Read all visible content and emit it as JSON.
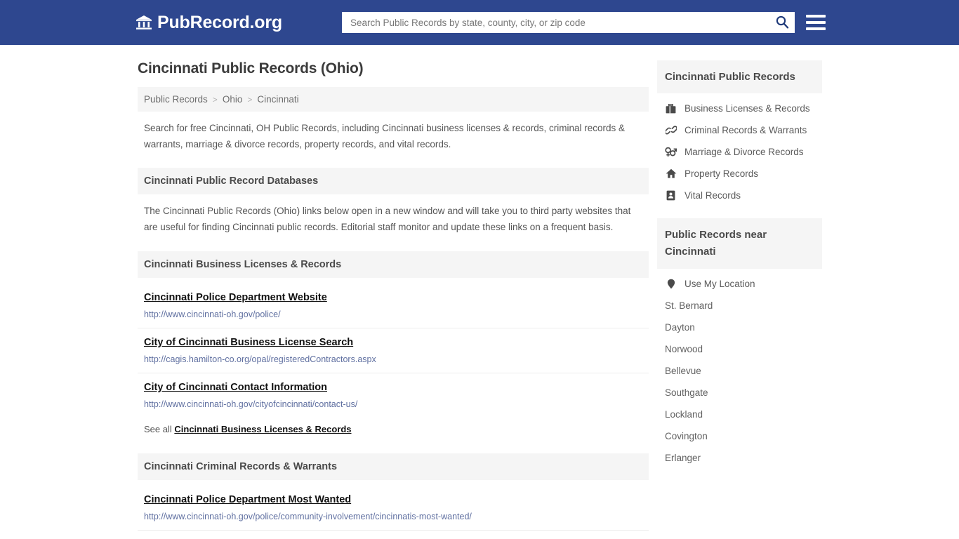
{
  "header": {
    "brand_name": "PubRecord.org",
    "brand_icon": "bank-building-icon",
    "search_placeholder": "Search Public Records by state, county, city, or zip code",
    "search_value": "",
    "search_icon": "search-icon",
    "menu_icon": "hamburger-menu-icon",
    "bg_color": "#2e478f"
  },
  "main": {
    "page_title": "Cincinnati Public Records (Ohio)",
    "breadcrumb": {
      "items": [
        "Public Records",
        "Ohio",
        "Cincinnati"
      ],
      "separator": ">"
    },
    "intro_text": "Search for free Cincinnati, OH Public Records, including Cincinnati business licenses & records, criminal records & warrants, marriage & divorce records, property records, and vital records.",
    "databases_section": {
      "heading": "Cincinnati Public Record Databases",
      "text": "The Cincinnati Public Records (Ohio) links below open in a new window and will take you to third party websites that are useful for finding Cincinnati public records. Editorial staff monitor and update these links on a frequent basis."
    },
    "sections": [
      {
        "heading": "Cincinnati Business Licenses & Records",
        "entries": [
          {
            "title": "Cincinnati Police Department Website",
            "url": "http://www.cincinnati-oh.gov/police/"
          },
          {
            "title": "City of Cincinnati Business License Search",
            "url": "http://cagis.hamilton-co.org/opal/registeredContractors.aspx"
          },
          {
            "title": "City of Cincinnati Contact Information",
            "url": "http://www.cincinnati-oh.gov/cityofcincinnati/contact-us/"
          }
        ],
        "see_all_prefix": "See all",
        "see_all_label": "Cincinnati Business Licenses & Records"
      },
      {
        "heading": "Cincinnati Criminal Records & Warrants",
        "entries": [
          {
            "title": "Cincinnati Police Department Most Wanted",
            "url": "http://www.cincinnati-oh.gov/police/community-involvement/cincinnatis-most-wanted/"
          }
        ],
        "see_all_prefix": "",
        "see_all_label": ""
      }
    ]
  },
  "sidebar": {
    "records_panel": {
      "heading": "Cincinnati Public Records",
      "items": [
        {
          "label": "Business Licenses & Records",
          "icon": "briefcase-icon"
        },
        {
          "label": "Criminal Records & Warrants",
          "icon": "chain-link-icon"
        },
        {
          "label": "Marriage & Divorce Records",
          "icon": "venus-mars-icon"
        },
        {
          "label": "Property Records",
          "icon": "home-icon"
        },
        {
          "label": "Vital Records",
          "icon": "id-badge-icon"
        }
      ]
    },
    "nearby_panel": {
      "heading": "Public Records near Cincinnati",
      "location_item": {
        "label": "Use My Location",
        "icon": "map-pin-icon"
      },
      "cities": [
        "St. Bernard",
        "Dayton",
        "Norwood",
        "Bellevue",
        "Southgate",
        "Lockland",
        "Covington",
        "Erlanger"
      ]
    }
  }
}
